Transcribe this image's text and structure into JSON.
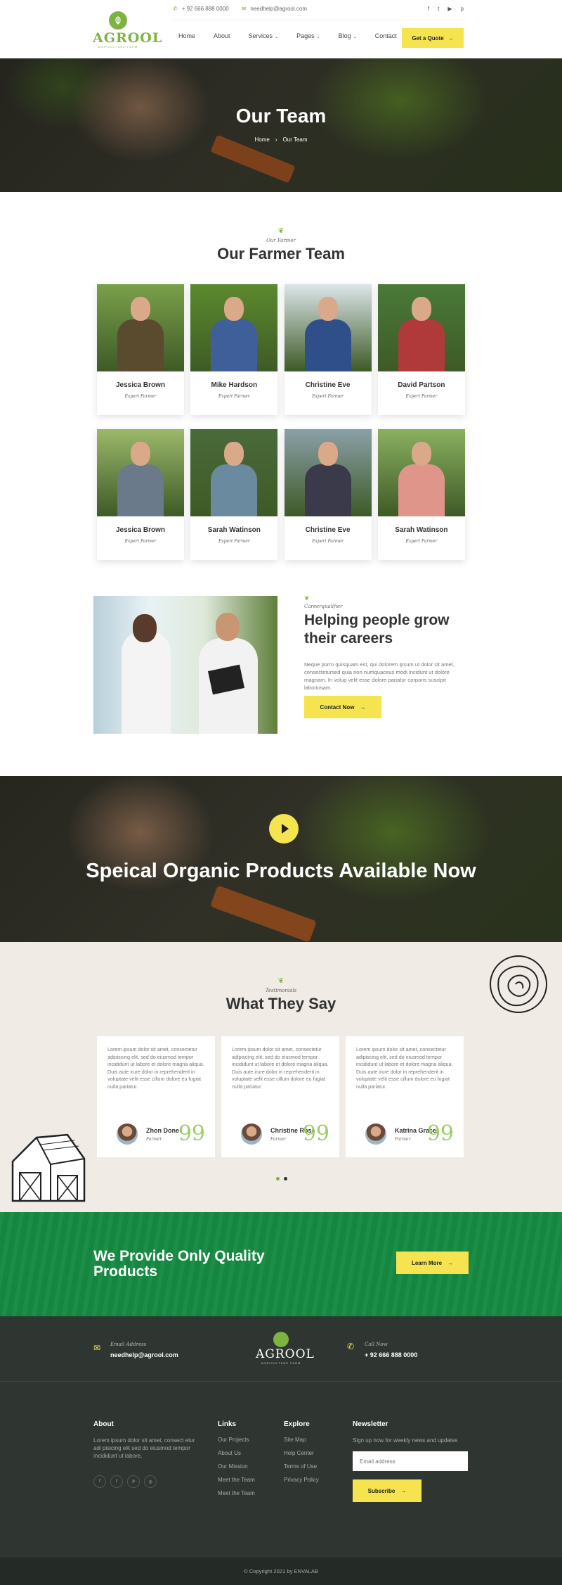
{
  "header": {
    "logo_name": "AGROOL",
    "logo_tag": "AGRICULTURE FARM",
    "phone": "+ 92 666 888 0000",
    "email": "needhelp@agrool.com",
    "social": [
      "f",
      "t",
      "▶",
      "p"
    ],
    "nav": [
      {
        "label": "Home",
        "dropdown": false
      },
      {
        "label": "About",
        "dropdown": false
      },
      {
        "label": "Services",
        "dropdown": true
      },
      {
        "label": "Pages",
        "dropdown": true
      },
      {
        "label": "Blog",
        "dropdown": true
      },
      {
        "label": "Contact",
        "dropdown": false
      }
    ],
    "quote_button": "Get a Quote"
  },
  "hero": {
    "title": "Our Team",
    "breadcrumb": [
      "Home",
      "Our Team"
    ]
  },
  "team": {
    "subtitle": "Our Farmer",
    "title": "Our Farmer Team",
    "members": [
      {
        "name": "Jessica Brown",
        "role": "Expert Farmer",
        "bg": "#7aa04a",
        "shirt": "#5a4a2e"
      },
      {
        "name": "Mike Hardson",
        "role": "Expert Farmer",
        "bg": "#5c8a2e",
        "shirt": "#3f5f9a"
      },
      {
        "name": "Christine Eve",
        "role": "Expert Farmer",
        "bg": "#dce6ea",
        "shirt": "#2f4f8a"
      },
      {
        "name": "David Partson",
        "role": "Expert Farmer",
        "bg": "#4a7a3a",
        "shirt": "#b03a3a"
      },
      {
        "name": "Jessica Brown",
        "role": "Expert Farmer",
        "bg": "#9bb86a",
        "shirt": "#6a7a8a"
      },
      {
        "name": "Sarah Watinson",
        "role": "Expert Farmer",
        "bg": "#4b6a3a",
        "shirt": "#6a8aa0"
      },
      {
        "name": "Christine Eve",
        "role": "Expert Farmer",
        "bg": "#8aa0a8",
        "shirt": "#3a3a4a"
      },
      {
        "name": "Sarah Watinson",
        "role": "Expert Farmer",
        "bg": "#8ab060",
        "shirt": "#e0958a"
      }
    ]
  },
  "careers": {
    "subtitle": "Careerqualifier",
    "title": "Helping people grow their careers",
    "text": "Neque porro quisquam est, qui dolorem ipsum ut dolor sit amet, consectetursed quia non numquaceus modi incidunt ut dolore magnam. In volup velit esse dolore pariatur corporis suscipit laboriosam.",
    "button": "Contact Now"
  },
  "video": {
    "title": "Speical Organic Products Available Now"
  },
  "testimonials": {
    "subtitle": "Testimonials",
    "title": "What They Say",
    "items": [
      {
        "text": "Lorem ipsum dolor sit amet, consectetur adipiscing elit, sed do eiusmod tempor incididunt ut labore et dolore magna aliqua. Duis aute irure dolor in reprehenderit in voluptate velit esse cillum dolore eu fugiat nulla pariatur.",
        "name": "Zhon Done",
        "role": "Farmer"
      },
      {
        "text": "Lorem ipsum dolor sit amet, consectetur adipiscing elit, sed do eiusmod tempor incididunt ut labore et dolore magna aliqua. Duis aute irure dolor in reprehenderit in voluptate velit esse cillum dolore eu fugiat nulla pariatur.",
        "name": "Christine Rose",
        "role": "Farmer"
      },
      {
        "text": "Lorem ipsum dolor sit amet, consectetur adipiscing elit, sed do eiusmod tempor incididunt ut labore et dolore magna aliqua. Duis aute irure dolor in reprehenderit in voluptate velit esse cillum dolore eu fugiat nulla pariatur.",
        "name": "Katrina Grace",
        "role": "Farmer"
      }
    ],
    "active_dot": 0
  },
  "cta": {
    "title": "We Provide Only Quality Products",
    "button": "Learn More"
  },
  "footer": {
    "email_label": "Email Address",
    "email": "needhelp@agrool.com",
    "call_label": "Call Now",
    "phone": "+ 92 666 888 0000",
    "about_title": "About",
    "about_text": "Lorem ipsum dolor sit amet, consect etur adi pisicing elit sed do eiusmod tempor incididunt ut labore.",
    "social": [
      "f",
      "t",
      "p",
      "◎"
    ],
    "links_title": "Links",
    "links": [
      "Our Projects",
      "About Us",
      "Our Mission",
      "Meet the Team",
      "Meet the Team"
    ],
    "explore_title": "Explore",
    "explore": [
      "Site Map",
      "Help Center",
      "Terms of Use",
      "Privacy Policy"
    ],
    "newsletter_title": "Newsletter",
    "newsletter_text": "Sign up now for weekly news and updates",
    "email_placeholder": "Email address",
    "subscribe": "Subscribe",
    "copyright": "© Copyright 2021 by ENVALAB"
  },
  "colors": {
    "accent": "#f5e44f",
    "green": "#7cb342",
    "cta_green": "#168a42",
    "footer": "#2f3631"
  }
}
